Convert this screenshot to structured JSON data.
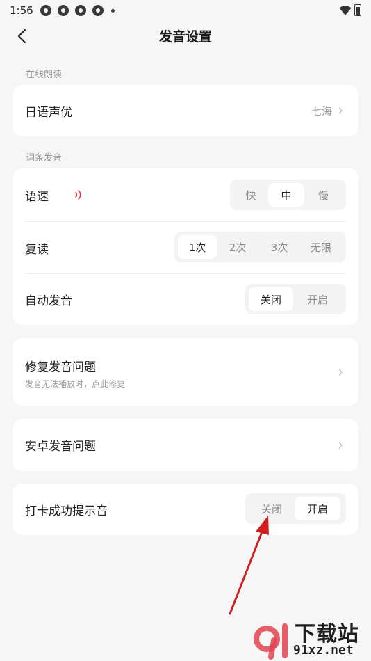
{
  "status_bar": {
    "time": "1:56"
  },
  "header": {
    "title": "发音设置"
  },
  "section_online": {
    "label": "在线朗读"
  },
  "voice_row": {
    "label": "日语声优",
    "value": "七海"
  },
  "section_word": {
    "label": "词条发音"
  },
  "speed_row": {
    "label": "语速",
    "options": [
      "快",
      "中",
      "慢"
    ],
    "selected": "中"
  },
  "repeat_row": {
    "label": "复读",
    "options": [
      "1次",
      "2次",
      "3次",
      "无限"
    ],
    "selected": "1次"
  },
  "auto_row": {
    "label": "自动发音",
    "options": [
      "关闭",
      "开启"
    ],
    "selected": "关闭"
  },
  "fix_row": {
    "label": "修复发音问题",
    "sub": "发音无法播放时，点此修复"
  },
  "android_row": {
    "label": "安卓发音问题"
  },
  "checkin_row": {
    "label": "打卡成功提示音",
    "options": [
      "关闭",
      "开启"
    ],
    "selected": "开启"
  },
  "watermark": {
    "text1": "下载站",
    "text2": "91xz.net"
  },
  "colors": {
    "accent": "#e8384f",
    "arrow": "#d01f1f",
    "background": "#f6f6f6"
  }
}
